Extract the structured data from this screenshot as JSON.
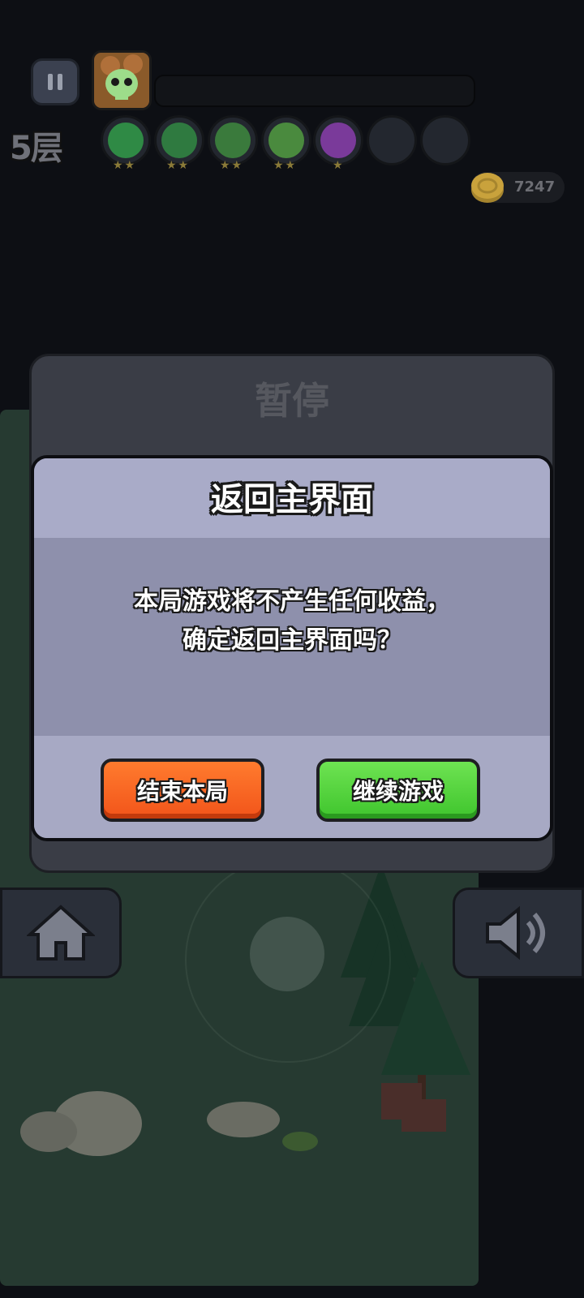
{
  "hud": {
    "floor": "5层",
    "coins": "7247",
    "skills": [
      {
        "icon": "bow-skill-icon",
        "stars": "★★",
        "color": "#2f8a45"
      },
      {
        "icon": "dagger-skill-icon",
        "stars": "★★",
        "color": "#2f7a40"
      },
      {
        "icon": "cane-skill-icon",
        "stars": "★★",
        "color": "#3a7a3c"
      },
      {
        "icon": "whirlwind-skill-icon",
        "stars": "★★",
        "color": "#4a8a3e"
      },
      {
        "icon": "potion-skill-icon",
        "stars": "★",
        "color": "#7a3a9a"
      },
      {
        "icon": "empty-slot",
        "stars": "",
        "color": "#23272f"
      },
      {
        "icon": "empty-slot",
        "stars": "",
        "color": "#23272f"
      }
    ]
  },
  "pause_panel": {
    "title": "暂停"
  },
  "dialog": {
    "title": "返回主界面",
    "message_line1": "本局游戏将不产生任何收益，",
    "message_line2": "确定返回主界面吗？",
    "end_button": "结束本局",
    "continue_button": "继续游戏"
  },
  "colors": {
    "end_button": "#f2541a",
    "continue_button": "#3fc52d",
    "dialog_bg": "#8e90ac"
  }
}
